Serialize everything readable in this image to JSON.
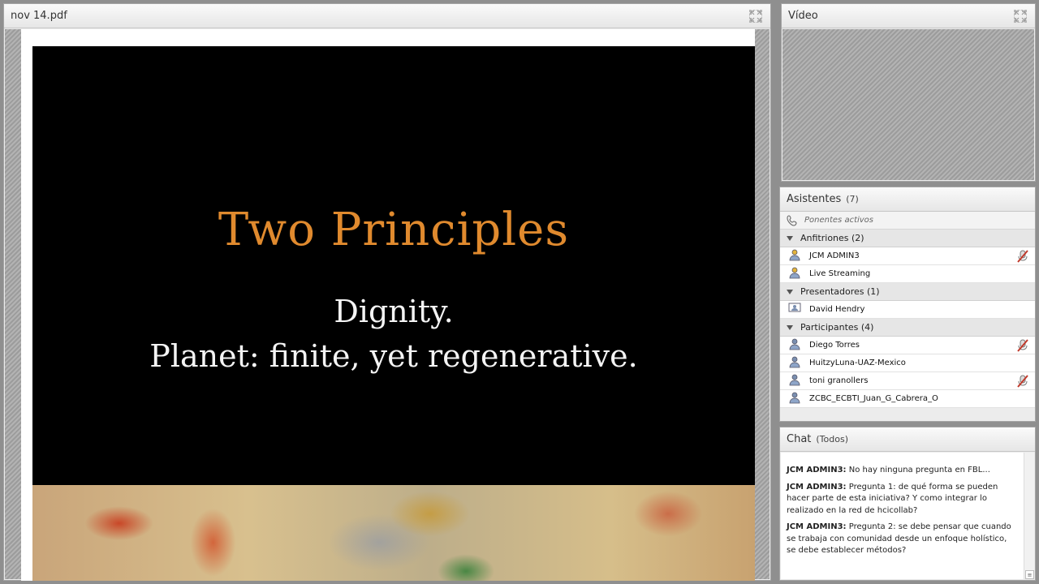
{
  "share_pod": {
    "title": "nov 14.pdf"
  },
  "slide": {
    "title": "Two Principles",
    "line1": "Dignity.",
    "line2": "Planet: finite, yet regenerative."
  },
  "video_pod": {
    "title": "Vídeo"
  },
  "attendees": {
    "title": "Asistentes",
    "count": "(7)",
    "active_speakers": "Ponentes activos",
    "groups": [
      {
        "label": "Anfitriones (2)",
        "members": [
          {
            "name": "JCM ADMIN3",
            "mic": true,
            "icon": "host-user-icon"
          },
          {
            "name": "Live Streaming",
            "mic": false,
            "icon": "host-user-icon"
          }
        ]
      },
      {
        "label": "Presentadores (1)",
        "members": [
          {
            "name": "David Hendry",
            "mic": false,
            "icon": "presenter-user-icon"
          }
        ]
      },
      {
        "label": "Participantes (4)",
        "members": [
          {
            "name": "Diego Torres",
            "mic": true,
            "icon": "participant-user-icon"
          },
          {
            "name": "HuitzyLuna-UAZ-Mexico",
            "mic": false,
            "icon": "participant-user-icon"
          },
          {
            "name": "toni granollers",
            "mic": true,
            "icon": "participant-user-icon"
          },
          {
            "name": "ZCBC_ECBTI_Juan_G_Cabrera_O",
            "mic": false,
            "icon": "participant-user-icon"
          }
        ]
      }
    ]
  },
  "chat": {
    "title": "Chat",
    "scope": "(Todos)",
    "messages": [
      {
        "sender": "JCM ADMIN3:",
        "text": "No hay ninguna pregunta en FBL..."
      },
      {
        "sender": "JCM ADMIN3:",
        "text": "Pregunta 1:  de qué forma se pueden hacer parte de esta iniciativa? Y como integrar lo realizado en la red de hcicollab?"
      },
      {
        "sender": "JCM ADMIN3:",
        "text": "Pregunta 2: se debe pensar que cuando se trabaja con comunidad desde un enfoque holístico, se debe establecer métodos?"
      }
    ],
    "scroll_glyph": "≡"
  },
  "colors": {
    "slide_title": "#e08a2e",
    "slide_bg": "#000000",
    "mic_active": "#c0392b"
  }
}
